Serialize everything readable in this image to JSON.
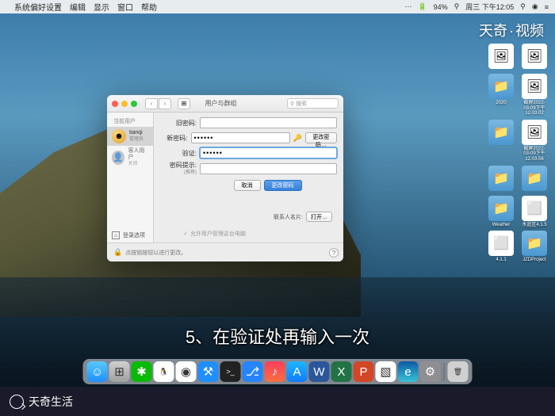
{
  "menubar": {
    "app": "系统偏好设置",
    "items": [
      "编辑",
      "显示",
      "窗口",
      "帮助"
    ],
    "battery_pct": "94%",
    "datetime": "周三 下午12:05",
    "extra_icons": [
      "battery",
      "wifi",
      "search",
      "control"
    ]
  },
  "watermark": {
    "left": "天奇",
    "right": "视频"
  },
  "desktop_icons": [
    {
      "type": "img",
      "label": ""
    },
    {
      "type": "img",
      "label": ""
    },
    {
      "type": "folder",
      "label": "2020"
    },
    {
      "type": "img",
      "label": "截屏2022-03-09下午12.03.02"
    },
    {
      "type": "folder",
      "label": ""
    },
    {
      "type": "img",
      "label": "截屏2022-03-09下午12.03.56"
    },
    {
      "type": "folder",
      "label": ""
    },
    {
      "type": "folder",
      "label": ""
    },
    {
      "type": "folder",
      "label": "Weather"
    },
    {
      "type": "app",
      "label": "水盆区4.1.5"
    },
    {
      "type": "app",
      "label": "4.1.1"
    },
    {
      "type": "folder",
      "label": "JZDProject"
    }
  ],
  "prefs": {
    "title": "用户与群组",
    "search_placeholder": "搜索",
    "sidebar": {
      "section": "当前用户",
      "user_name": "tianqi",
      "user_role": "管理员",
      "guest_label": "客人用户",
      "guest_status": "关闭",
      "login_options": "登录选项"
    },
    "form": {
      "old_pwd_label": "旧密码:",
      "new_pwd_label": "新密码:",
      "new_pwd_value": "••••••",
      "verify_label": "验证:",
      "verify_value": "••••••",
      "hint_label": "密码提示:",
      "hint_sub": "(推荐)",
      "change_btn": "更改密码…",
      "cancel_btn": "取消",
      "confirm_btn": "更改密码",
      "contact_label": "联系人名片:",
      "open_btn": "打开…",
      "allow_admin": "允许用户管理这台电脑"
    },
    "footer": {
      "lock_text": "点按锁按钮以进行更改。"
    }
  },
  "caption": "5、在验证处再输入一次",
  "dock": [
    {
      "name": "finder",
      "bg": "linear-gradient(#5ac8fa,#1e90ff)",
      "glyph": "☺"
    },
    {
      "name": "launchpad",
      "bg": "linear-gradient(#d0d0d0,#a0a0a0)",
      "glyph": "⊞"
    },
    {
      "name": "wechat",
      "bg": "#09bb07",
      "glyph": "✱"
    },
    {
      "name": "qq",
      "bg": "#fff",
      "glyph": "🐧"
    },
    {
      "name": "chrome",
      "bg": "#fff",
      "glyph": "◉"
    },
    {
      "name": "xcode",
      "bg": "#1f8fff",
      "glyph": "⚒"
    },
    {
      "name": "terminal",
      "bg": "#222",
      "glyph": ">_"
    },
    {
      "name": "sourcetree",
      "bg": "#2684ff",
      "glyph": "⎇"
    },
    {
      "name": "music",
      "bg": "linear-gradient(#fa3e5f,#fa6e3f)",
      "glyph": "♪"
    },
    {
      "name": "appstore",
      "bg": "linear-gradient(#1fb6ff,#0f7bff)",
      "glyph": "A"
    },
    {
      "name": "word",
      "bg": "#2b579a",
      "glyph": "W"
    },
    {
      "name": "excel",
      "bg": "#217346",
      "glyph": "X"
    },
    {
      "name": "powerpoint",
      "bg": "#d24726",
      "glyph": "P"
    },
    {
      "name": "preview",
      "bg": "#fff",
      "glyph": "▧"
    },
    {
      "name": "edge",
      "bg": "linear-gradient(#0c59a4,#39c2d7)",
      "glyph": "e"
    },
    {
      "name": "sysprefs",
      "bg": "#8e8e93",
      "glyph": "⚙"
    },
    {
      "name": "trash",
      "bg": "#d0d0d0",
      "glyph": "🗑"
    }
  ],
  "brand": "天奇生活"
}
